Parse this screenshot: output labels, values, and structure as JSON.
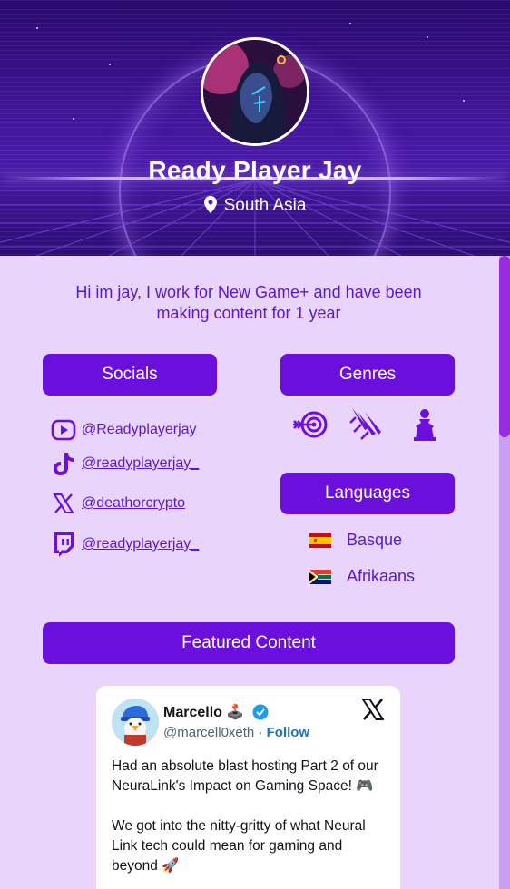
{
  "profile": {
    "name": "Ready Player Jay",
    "location": "South Asia",
    "bio": "Hi im jay, I work for New Game+ and have been making content for 1 year"
  },
  "sections": {
    "socials": "Socials",
    "genres": "Genres",
    "languages": "Languages",
    "featured": "Featured Content"
  },
  "socials": [
    {
      "platform": "youtube-icon",
      "handle": "@Readyplayerjay"
    },
    {
      "platform": "tiktok-icon",
      "handle": "@readyplayerjay_"
    },
    {
      "platform": "x-icon",
      "handle": "@deathorcrypto"
    },
    {
      "platform": "twitch-icon",
      "handle": "@readyplayerjay_"
    }
  ],
  "genres": [
    "target-arrow-icon",
    "claw-slash-icon",
    "board-game-pawn-icon"
  ],
  "languages": [
    {
      "name": "Basque",
      "flag": "spain-flag-icon"
    },
    {
      "name": "Afrikaans",
      "flag": "south-africa-flag-icon"
    }
  ],
  "tweet": {
    "author": "Marcello 🕹️",
    "handle": "@marcell0xeth",
    "separator": "·",
    "follow": "Follow",
    "text": "Had an absolute blast hosting Part 2 of our NeuraLink's Impact on Gaming Space! 🎮\n\nWe got into the nitty-gritty of what Neural Link tech could mean for gaming and beyond 🚀"
  },
  "colors": {
    "accent": "#6a0fdc",
    "page_bg": "#e9d5fc",
    "text_purple": "#5b18c9",
    "hero_dark": "#2a0a6e"
  }
}
